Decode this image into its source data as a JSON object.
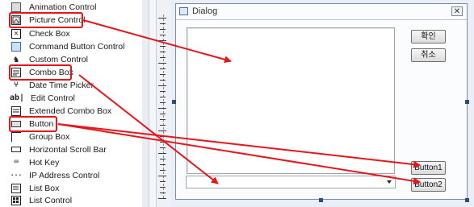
{
  "toolbox": {
    "items": [
      {
        "label": "Animation Control",
        "icon": "animation-icon"
      },
      {
        "label": "Picture Control",
        "icon": "picture-icon"
      },
      {
        "label": "Check Box",
        "icon": "checkbox-icon"
      },
      {
        "label": "Command Button Control",
        "icon": "command-button-icon"
      },
      {
        "label": "Custom Control",
        "icon": "custom-control-icon"
      },
      {
        "label": "Combo Box",
        "icon": "combobox-icon"
      },
      {
        "label": "Date Time Picker",
        "icon": "datetime-icon"
      },
      {
        "label": "Edit Control",
        "icon": "edit-icon"
      },
      {
        "label": "Extended Combo Box",
        "icon": "extended-combo-icon"
      },
      {
        "label": "Button",
        "icon": "button-icon"
      },
      {
        "label": "Group Box",
        "icon": "groupbox-icon"
      },
      {
        "label": "Horizontal Scroll Bar",
        "icon": "hscroll-icon"
      },
      {
        "label": "Hot Key",
        "icon": "hotkey-icon"
      },
      {
        "label": "IP Address Control",
        "icon": "ipaddress-icon"
      },
      {
        "label": "List Box",
        "icon": "listbox-icon"
      },
      {
        "label": "List Control",
        "icon": "listcontrol-icon"
      }
    ]
  },
  "dialog": {
    "title": "Dialog",
    "close_glyph": "✕",
    "ok_label": "확인",
    "cancel_label": "취소",
    "button1_label": "Button1",
    "button2_label": "Button2"
  },
  "colors": {
    "highlight": "#e8141a",
    "arrow": "#e8141a",
    "canvas": "#eaeff7"
  }
}
